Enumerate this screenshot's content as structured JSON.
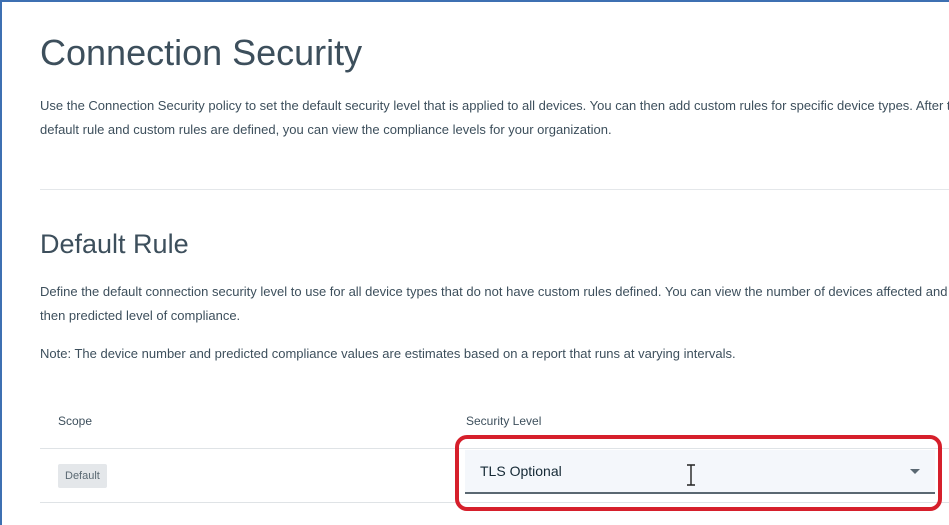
{
  "header": {
    "title": "Connection Security",
    "description": "Use the Connection Security policy to set the default security level that is applied to all devices. You can then add custom rules for specific device types. After the default rule and custom rules are defined, you can view the compliance levels for your organization."
  },
  "default_rule": {
    "title": "Default Rule",
    "description": "Define the default connection security level to use for all device types that do not have custom rules defined. You can view the number of devices affected and then predicted level of compliance.",
    "note": "Note: The device number and predicted compliance values are estimates based on a report that runs at varying intervals."
  },
  "table": {
    "columns": [
      "Scope",
      "Security Level"
    ],
    "rows": [
      {
        "scope": "Default",
        "security_level": "TLS Optional"
      }
    ]
  },
  "colors": {
    "highlight": "#d61f2b",
    "frame": "#3d70b2"
  },
  "icons": {
    "dropdown": "caret-down-icon",
    "cursor": "text-cursor-icon"
  }
}
